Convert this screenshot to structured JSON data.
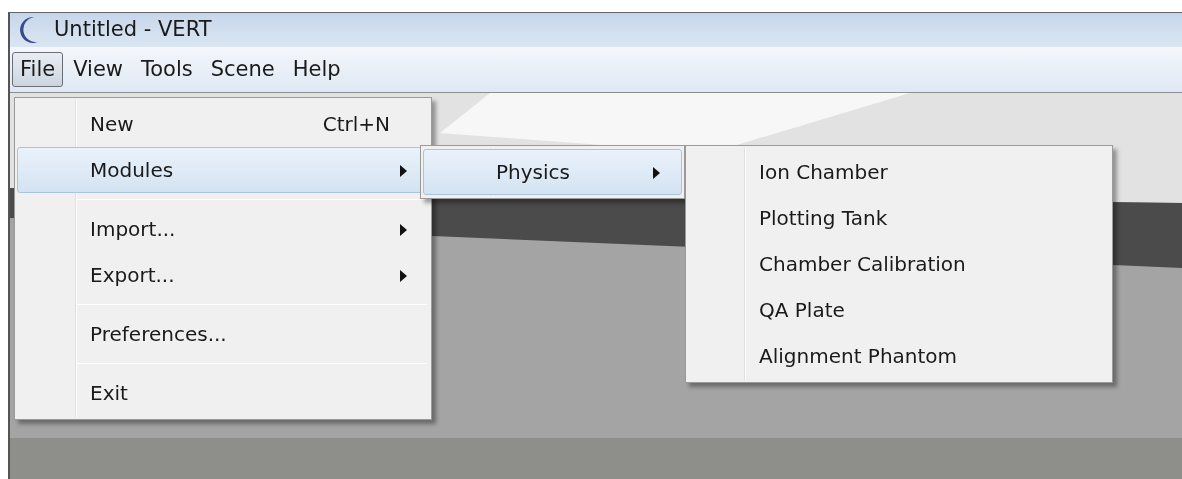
{
  "window": {
    "title": "Untitled - VERT"
  },
  "menubar": [
    {
      "label": "File",
      "selected": true
    },
    {
      "label": "View",
      "selected": false
    },
    {
      "label": "Tools",
      "selected": false
    },
    {
      "label": "Scene",
      "selected": false
    },
    {
      "label": "Help",
      "selected": false
    }
  ],
  "file_menu": {
    "groups": [
      [
        {
          "label": "New",
          "kind": "command",
          "shortcut": "Ctrl+N",
          "selected": false
        },
        {
          "label": "Modules",
          "kind": "submenu",
          "selected": true,
          "children": [
            {
              "label": "Physics",
              "kind": "submenu",
              "selected": true,
              "children": [
                {
                  "label": "Ion Chamber",
                  "kind": "command",
                  "selected": false
                },
                {
                  "label": "Plotting Tank",
                  "kind": "command",
                  "selected": false
                },
                {
                  "label": "Chamber Calibration",
                  "kind": "command",
                  "selected": false
                },
                {
                  "label": "QA Plate",
                  "kind": "command",
                  "selected": false
                },
                {
                  "label": "Alignment Phantom",
                  "kind": "command",
                  "selected": false
                }
              ]
            }
          ]
        }
      ],
      [
        {
          "label": "Import...",
          "kind": "submenu",
          "selected": false
        },
        {
          "label": "Export...",
          "kind": "submenu",
          "selected": false
        }
      ],
      [
        {
          "label": "Preferences...",
          "kind": "command",
          "selected": false
        }
      ],
      [
        {
          "label": "Exit",
          "kind": "command",
          "selected": false
        }
      ]
    ]
  }
}
